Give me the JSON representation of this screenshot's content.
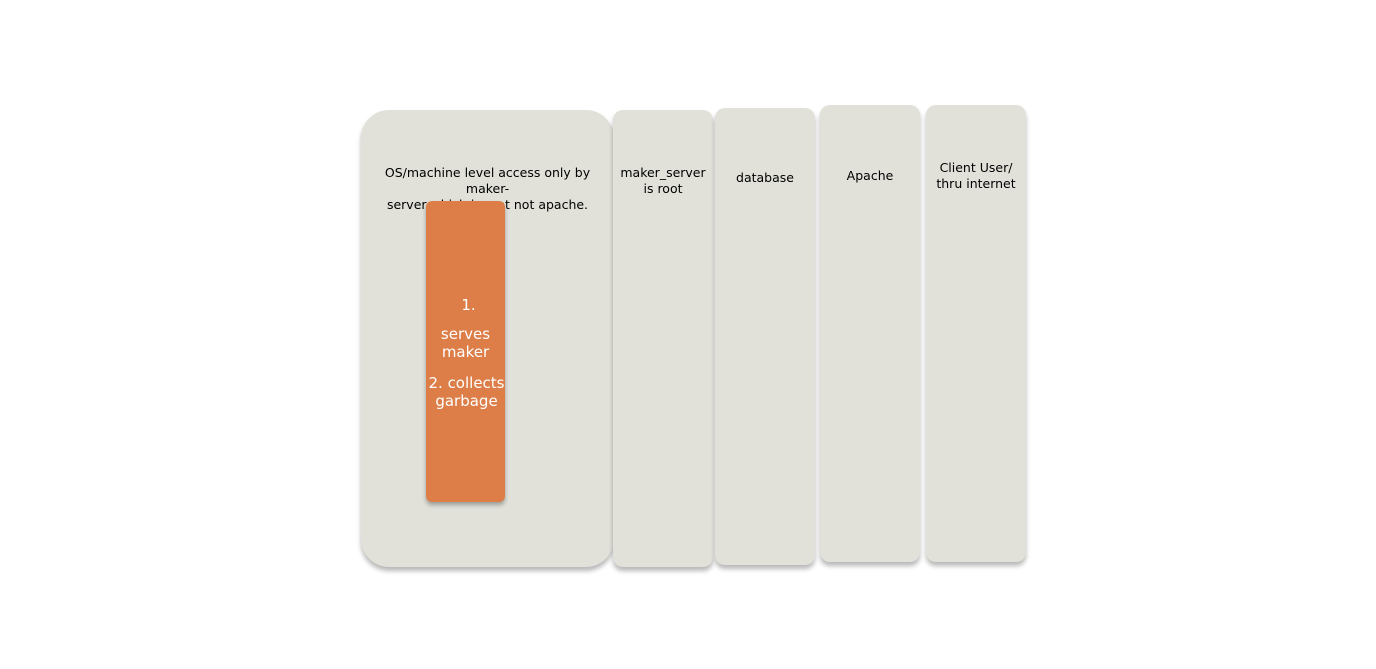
{
  "panels": {
    "os": "OS/machine level access only by maker-\nserver which is root not apache.",
    "maker_server": "maker_server\nis root",
    "database": "database",
    "apache": "Apache",
    "client": "Client User/\nthru internet"
  },
  "process_box": {
    "step1": "1.",
    "step1_text": "serves\nmaker",
    "step2": "2. collects\ngarbage"
  },
  "colors": {
    "panel": "#e1e1da",
    "process_box": "#dd7e48"
  }
}
